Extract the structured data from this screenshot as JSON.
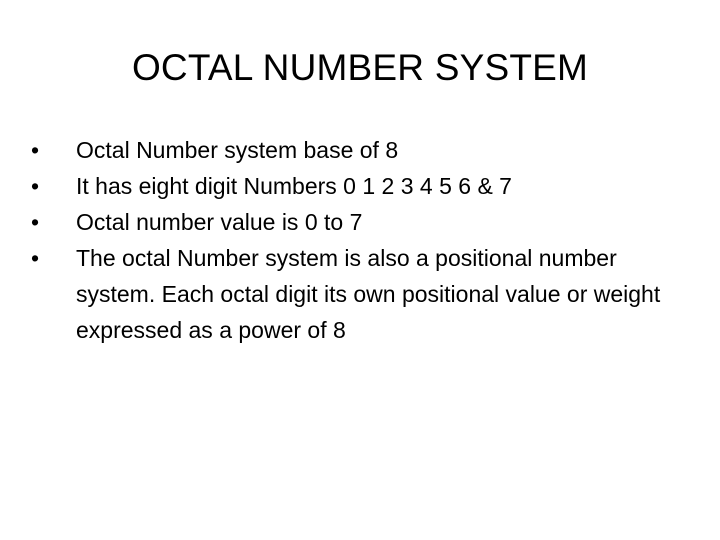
{
  "slide": {
    "title": "OCTAL NUMBER SYSTEM",
    "bullet_symbol": "•",
    "bullets": [
      {
        "text": "Octal Number system base of 8"
      },
      {
        "text": "It has eight digit Numbers 0 1 2 3 4 5 6 & 7"
      },
      {
        "text": "Octal number value is 0 to 7"
      },
      {
        "text": "The octal Number system is also a positional number system. Each octal digit its own positional value or weight expressed as a power of 8"
      }
    ]
  }
}
